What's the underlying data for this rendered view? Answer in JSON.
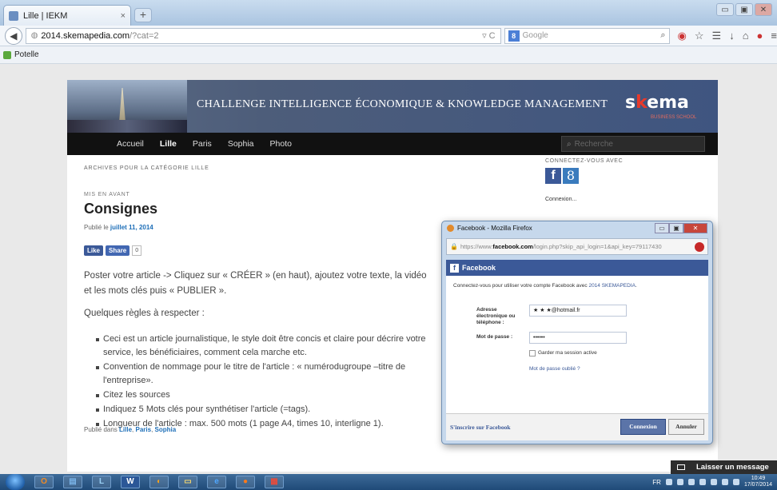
{
  "browser": {
    "tab_title": "Lille | IEKM",
    "tab_close": "×",
    "new_tab": "+",
    "url_host": "2014.skemapedia.com",
    "url_path": "/?cat=2",
    "search_placeholder": "Google",
    "bookmark": "Potelle"
  },
  "site": {
    "banner_title": "CHALLENGE INTELLIGENCE ÉCONOMIQUE & KNOWLEDGE MANAGEMENT",
    "logo_a": "s",
    "logo_k": "k",
    "logo_b": "ema",
    "tagline": "BUSINESS SCHOOL",
    "menu": [
      "Accueil",
      "Lille",
      "Paris",
      "Sophia",
      "Photo"
    ],
    "search_placeholder": "Recherche"
  },
  "article": {
    "archive_label": "ARCHIVES POUR LA CATÉGORIE LILLE",
    "featured": "MIS EN AVANT",
    "title": "Consignes",
    "meta_prefix": "Publié le ",
    "date": "juillet 11, 2014",
    "like": "Like",
    "share": "Share",
    "count": "0",
    "intro": "Poster votre article -> Cliquez sur « CRÉER » (en haut), ajoutez votre texte, la vidéo et les mots clés puis « PUBLIER ».",
    "rules_heading": "Quelques règles à respecter :",
    "rules": [
      "Ceci est un article journalistique, le style doit être concis et claire pour décrire votre service, les bénéficiaires, comment cela marche etc.",
      "Convention de nommage pour le titre de l'article : « numérodugroupe –titre de l'entreprise».",
      "Citez les sources",
      "Indiquez 5 Mots clés pour synthétiser l'article (=tags).",
      "Longueur de l'article : max. 500 mots (1 page A4, times 10, interligne 1)."
    ],
    "cats_prefix": "Publié dans ",
    "cats": [
      "Lille",
      "Paris",
      "Sophia"
    ]
  },
  "sidebar": {
    "connect_label": "CONNECTEZ-VOUS AVEC",
    "fb_glyph": "f",
    "g_glyph": "8",
    "connexion": "Connexion..."
  },
  "popup": {
    "window_title": "Facebook - Mozilla Firefox",
    "url_prefix": "https://www.",
    "url_host": "facebook.com",
    "url_rest": "/login.php?skip_api_login=1&api_key=79117430",
    "fb_title": "Facebook",
    "message_prefix": "Connectez-vous pour utiliser votre compte Facebook avec ",
    "app_name": "2014 SKEMAPEDIA",
    "message_suffix": ".",
    "email_label": "Adresse électronique ou téléphone :",
    "email_value": "★ ★ ★@hotmail.fr",
    "password_label": "Mot de passe :",
    "password_value": "••••••",
    "keep_session": "Garder ma session active",
    "forgot": "Mot de passe oublié ?",
    "register": "S'inscrire sur Facebook",
    "login_button": "Connexion",
    "cancel_button": "Annuler"
  },
  "widget": {
    "leave_message": "Laisser un message"
  },
  "taskbar": {
    "lang": "FR",
    "time": "10:49",
    "date": "17/07/2014"
  }
}
